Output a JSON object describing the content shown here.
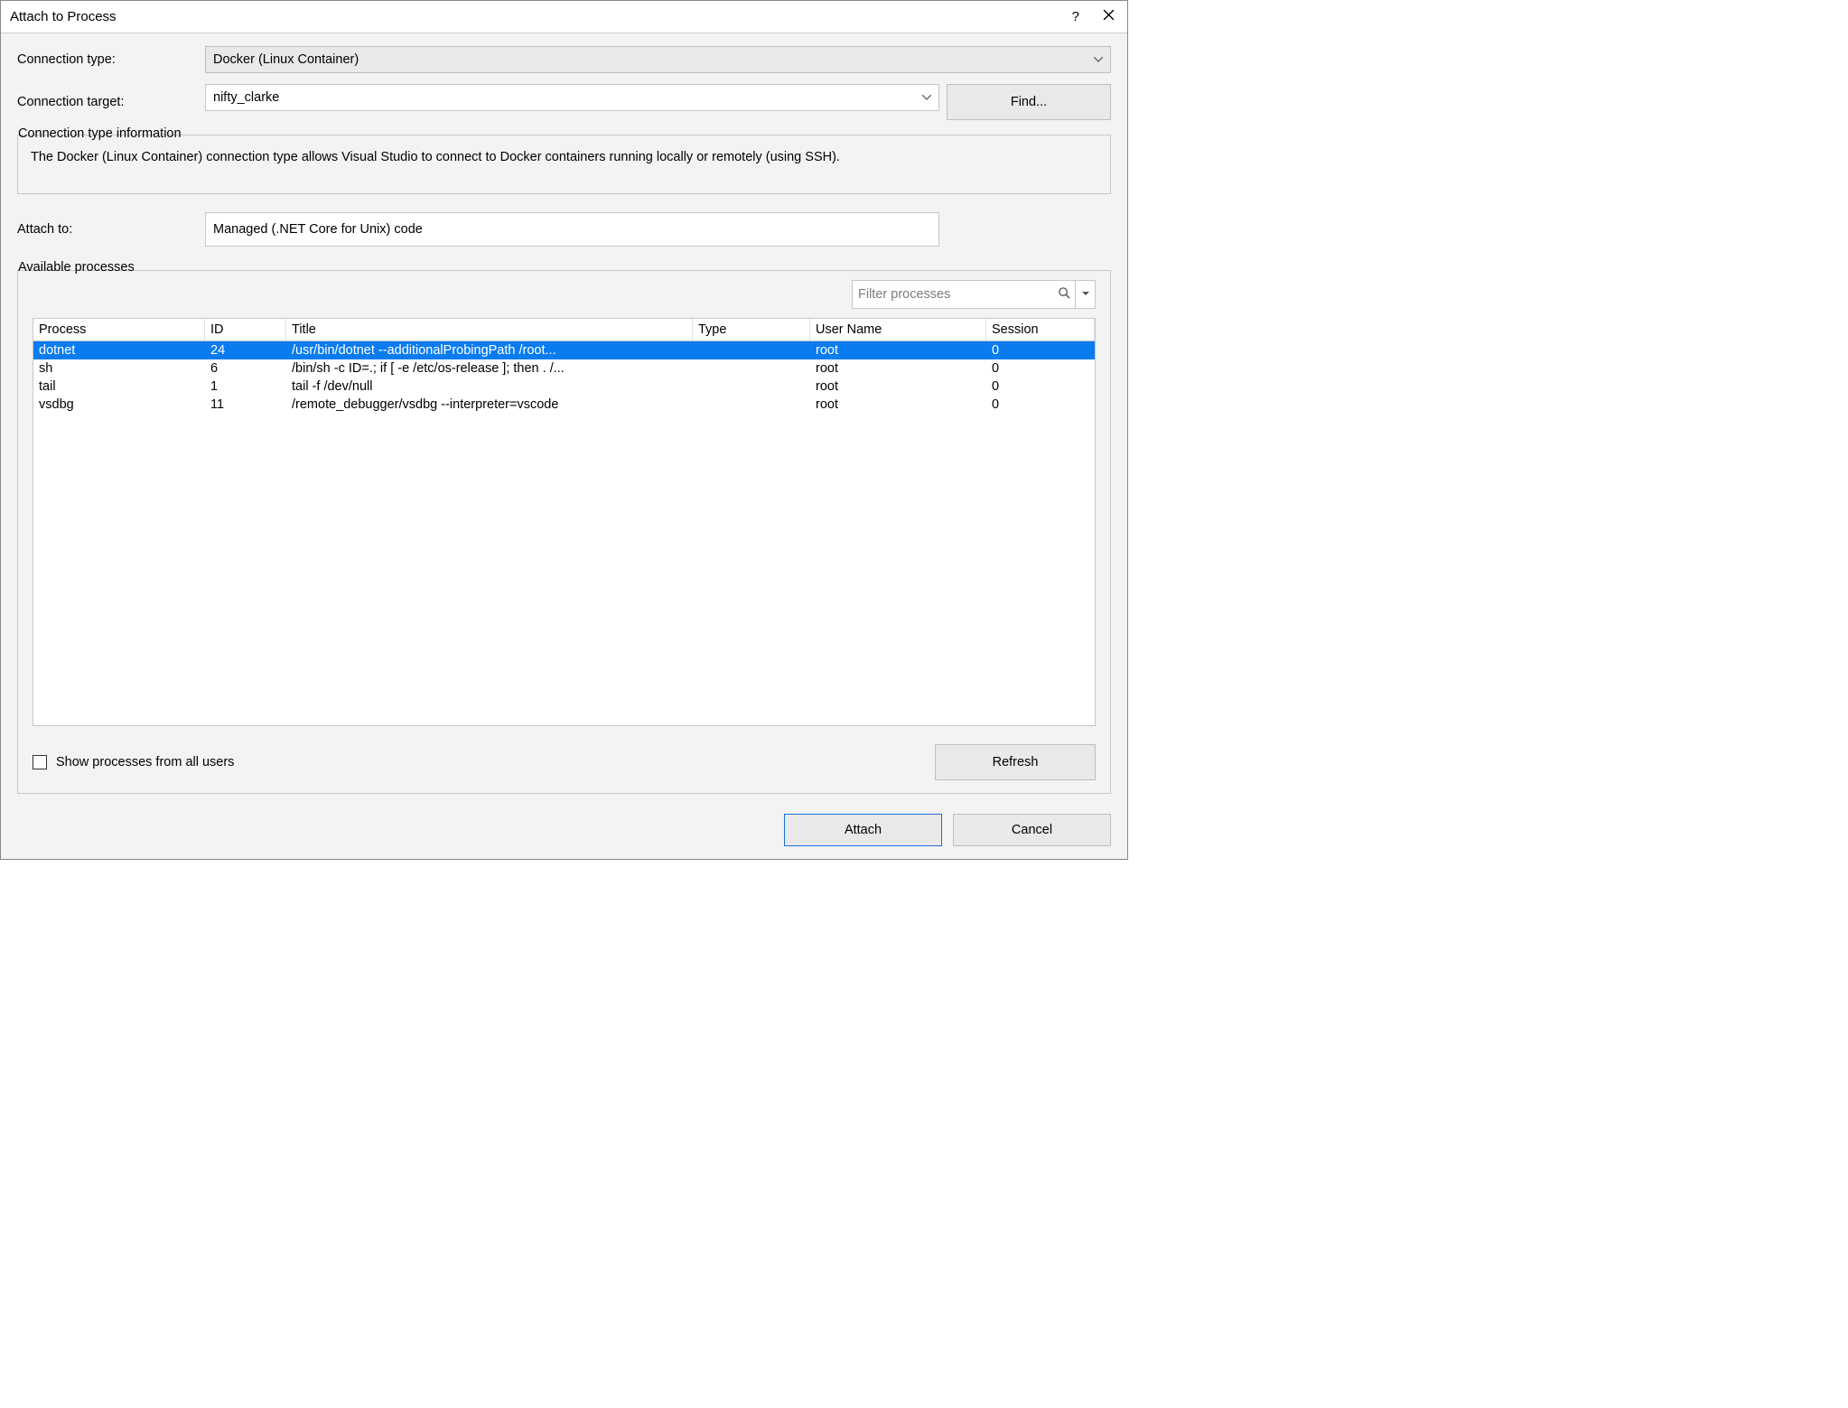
{
  "window": {
    "title": "Attach to Process"
  },
  "labels": {
    "connection_type": "Connection type:",
    "connection_target": "Connection target:",
    "attach_to": "Attach to:",
    "available_processes": "Available processes",
    "conn_info_heading": "Connection type information",
    "conn_info_text": "The Docker (Linux Container) connection type allows Visual Studio to connect to Docker containers running locally or remotely (using SSH).",
    "show_all": "Show processes from all users"
  },
  "fields": {
    "connection_type": "Docker (Linux Container)",
    "connection_target": "nifty_clarke",
    "attach_to": "Managed (.NET Core for Unix) code"
  },
  "buttons": {
    "find": "Find...",
    "refresh": "Refresh",
    "attach": "Attach",
    "cancel": "Cancel"
  },
  "filter": {
    "placeholder": "Filter processes"
  },
  "table": {
    "headers": {
      "process": "Process",
      "id": "ID",
      "title": "Title",
      "type": "Type",
      "user": "User Name",
      "session": "Session"
    },
    "rows": [
      {
        "process": "dotnet",
        "id": "24",
        "title": "/usr/bin/dotnet --additionalProbingPath /root...",
        "type": "",
        "user": "root",
        "session": "0",
        "selected": true
      },
      {
        "process": "sh",
        "id": "6",
        "title": "/bin/sh -c ID=.; if [ -e /etc/os-release ]; then . /...",
        "type": "",
        "user": "root",
        "session": "0",
        "selected": false
      },
      {
        "process": "tail",
        "id": "1",
        "title": "tail -f /dev/null",
        "type": "",
        "user": "root",
        "session": "0",
        "selected": false
      },
      {
        "process": "vsdbg",
        "id": "11",
        "title": "/remote_debugger/vsdbg --interpreter=vscode",
        "type": "",
        "user": "root",
        "session": "0",
        "selected": false
      }
    ]
  }
}
